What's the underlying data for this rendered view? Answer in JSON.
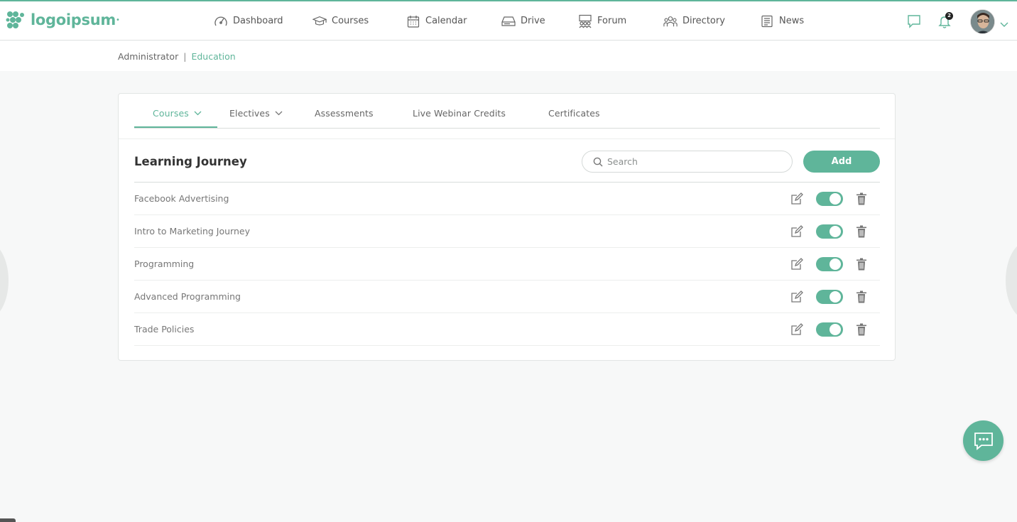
{
  "app": {
    "logo_text": "logoipsum"
  },
  "nav": {
    "items": [
      {
        "label": "Dashboard",
        "icon": "gauge-icon"
      },
      {
        "label": "Courses",
        "icon": "graduation-cap-icon"
      },
      {
        "label": "Calendar",
        "icon": "calendar-icon"
      },
      {
        "label": "Drive",
        "icon": "drive-icon"
      },
      {
        "label": "Forum",
        "icon": "forum-icon"
      },
      {
        "label": "Directory",
        "icon": "people-icon"
      },
      {
        "label": "News",
        "icon": "newspaper-icon"
      }
    ],
    "notification_count": "2"
  },
  "breadcrumb": {
    "root": "Administrator",
    "separator": "|",
    "current": "Education"
  },
  "tabs": [
    {
      "label": "Courses",
      "dropdown": true,
      "active": true
    },
    {
      "label": "Electives",
      "dropdown": true,
      "active": false
    },
    {
      "label": "Assessments",
      "dropdown": false,
      "active": false
    },
    {
      "label": "Live Webinar Credits",
      "dropdown": false,
      "active": false
    },
    {
      "label": "Certificates",
      "dropdown": false,
      "active": false
    }
  ],
  "section": {
    "title": "Learning Journey",
    "search_placeholder": "Search",
    "add_label": "Add"
  },
  "journeys": [
    {
      "name": "Facebook Advertising",
      "enabled": true
    },
    {
      "name": "Intro to Marketing Journey",
      "enabled": true
    },
    {
      "name": "Programming",
      "enabled": true
    },
    {
      "name": "Advanced Programming",
      "enabled": true
    },
    {
      "name": "Trade Policies",
      "enabled": true
    }
  ],
  "colors": {
    "accent": "#5fb59a",
    "text": "#333333",
    "muted": "#777777"
  }
}
